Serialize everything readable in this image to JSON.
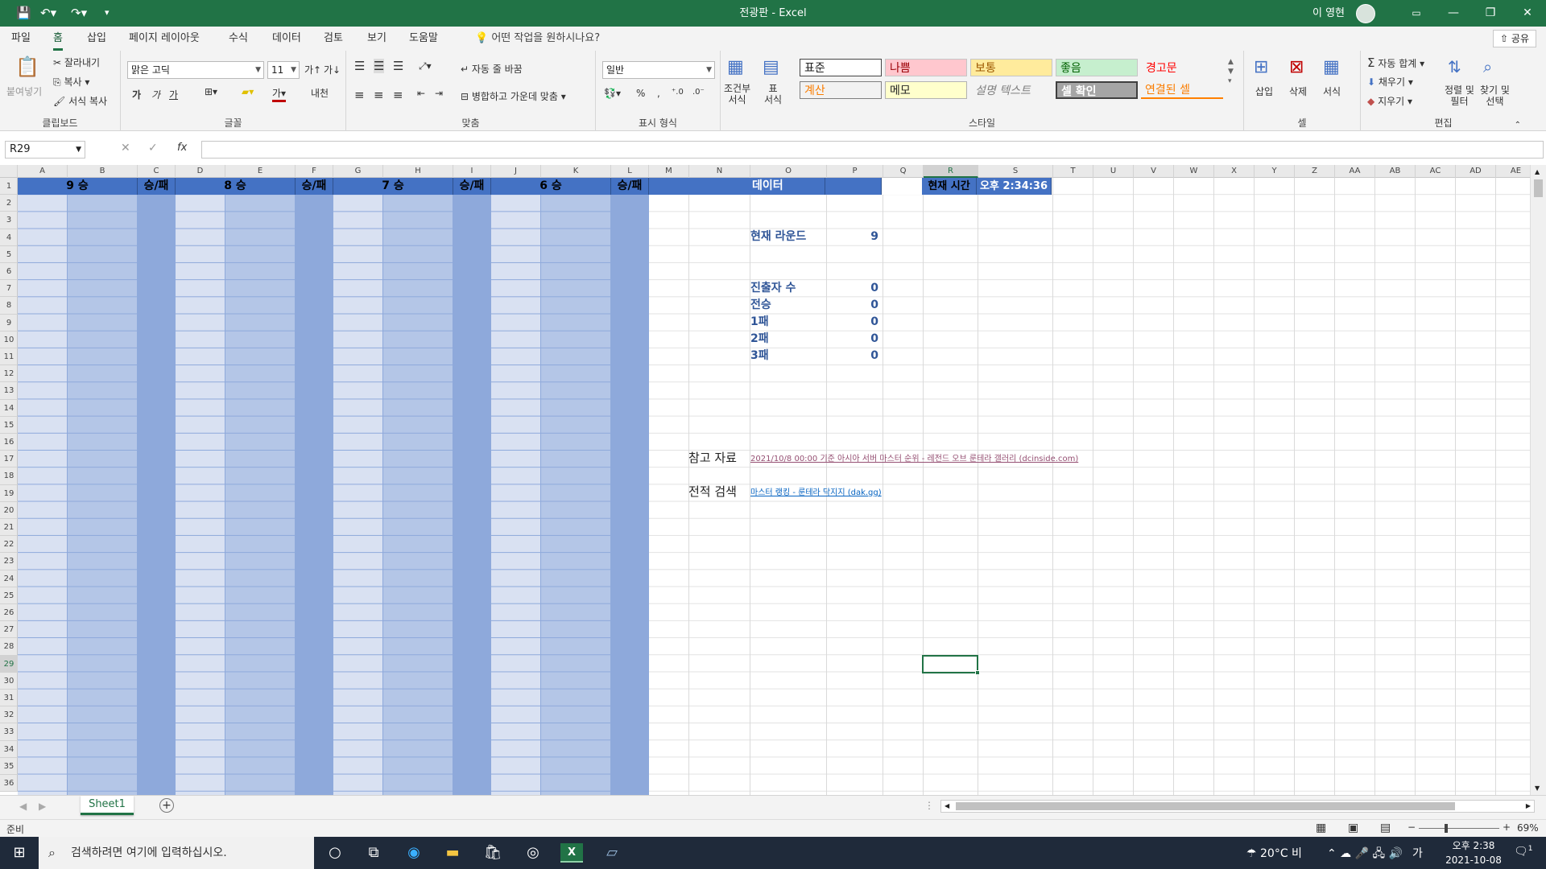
{
  "window": {
    "doc_title": "전광판",
    "sep": "-",
    "app": "Excel",
    "user_name": "이 영현"
  },
  "menu": {
    "tabs": [
      "파일",
      "홈",
      "삽입",
      "페이지 레이아웃",
      "수식",
      "데이터",
      "검토",
      "보기",
      "도움말"
    ],
    "tell_me": "어떤 작업을 원하시나요?",
    "share": "공유"
  },
  "ribbon": {
    "clipboard": {
      "paste": "붙여넣기",
      "cut": "잘라내기",
      "copy": "복사",
      "format_painter": "서식 복사",
      "label": "클립보드"
    },
    "font": {
      "name": "맑은 고딕",
      "size": "11",
      "label": "글꼴",
      "bold": "가",
      "italic": "가",
      "underline": "가",
      "strike": "가",
      "phonetic": "내천"
    },
    "align": {
      "wrap": "자동 줄 바꿈",
      "merge": "병합하고 가운데 맞춤",
      "label": "맞춤"
    },
    "number": {
      "format": "일반",
      "percent": "%",
      "comma": ",",
      "label": "표시 형식"
    },
    "styles": {
      "cond": "조건부\n서식",
      "table": "표\n서식",
      "cells": [
        "표준",
        "나쁨",
        "보통",
        "좋음",
        "경고문",
        "계산",
        "메모",
        "설명 텍스트",
        "셀 확인",
        "연결된 셀"
      ],
      "label": "스타일"
    },
    "cells": {
      "insert": "삽입",
      "delete": "삭제",
      "format": "서식",
      "label": "셀"
    },
    "editing": {
      "autosum": "자동 합계",
      "fill": "채우기",
      "clear": "지우기",
      "sort": "정렬 및\n필터",
      "find": "찾기 및\n선택",
      "label": "편집"
    }
  },
  "formula_bar": {
    "name_box": "R29",
    "content": ""
  },
  "columns": [
    "A",
    "B",
    "C",
    "D",
    "E",
    "F",
    "G",
    "H",
    "I",
    "J",
    "K",
    "L",
    "M",
    "N",
    "O",
    "P",
    "Q",
    "R",
    "S",
    "T",
    "U",
    "V",
    "W",
    "X",
    "Y",
    "Z",
    "AA",
    "AB",
    "AC",
    "AD",
    "AE"
  ],
  "rows": [
    "1",
    "2",
    "3",
    "4",
    "5",
    "6",
    "7",
    "8",
    "9",
    "10",
    "11",
    "12",
    "13",
    "14",
    "15",
    "16",
    "17",
    "18",
    "19",
    "20",
    "21",
    "22",
    "23",
    "24",
    "25",
    "26",
    "27",
    "28",
    "29",
    "30",
    "31",
    "32",
    "33",
    "34",
    "35",
    "36"
  ],
  "headers": {
    "w9": "9 승",
    "wl1": "승/패",
    "w8": "8 승",
    "wl2": "승/패",
    "w7": "7 승",
    "wl3": "승/패",
    "w6": "6 승",
    "wl4": "승/패",
    "data": "데이터",
    "time_label": "현재 시간",
    "time_value": "오후 2:34:36"
  },
  "stats": {
    "round_label": "현재 라운드",
    "round_value": "9",
    "advance_label": "진출자 수",
    "advance_value": "0",
    "unbeaten_label": "전승",
    "unbeaten_value": "0",
    "l1_label": "1패",
    "l1_value": "0",
    "l2_label": "2패",
    "l2_value": "0",
    "l3_label": "3패",
    "l3_value": "0"
  },
  "refs": {
    "ref_label": "참고 자료",
    "ref_link": "2021/10/8 00:00 기준 아시아 서버 마스터 순위 - 레전드 오브 룬테라 갤러리 (dcinside.com)",
    "search_label": "전적 검색",
    "search_link": "마스터 랭킹 - 룬테라 닥지지 (dak.gg)"
  },
  "sheet_tabs": [
    "Sheet1"
  ],
  "status": {
    "ready": "준비",
    "zoom": "69%"
  },
  "taskbar": {
    "search": "검색하려면 여기에 입력하십시오.",
    "weather": "20°C 비",
    "lang": "가",
    "time": "오후 2:38",
    "date": "2021-10-08",
    "notif": "1"
  },
  "colors": {
    "header_blue": "#4472c4",
    "col_light": "#d9e1f2",
    "col_mid": "#b4c6e7",
    "col_dark": "#8ea9db",
    "excel_green": "#217346",
    "text_blue": "#2f5597"
  }
}
